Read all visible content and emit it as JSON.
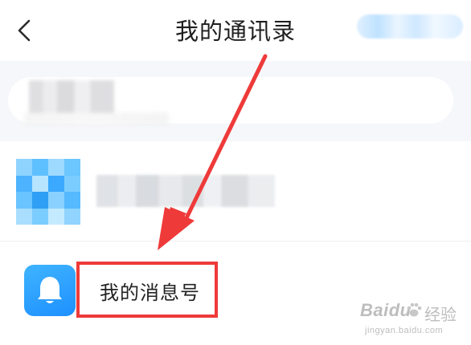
{
  "header": {
    "title": "我的通讯录",
    "back_icon": "chevron-left-icon",
    "action_text": ""
  },
  "search": {
    "placeholder": ""
  },
  "contacts": [
    {
      "name": "",
      "avatar": "avatar"
    }
  ],
  "message_account": {
    "label": "我的消息号",
    "icon": "bell-icon",
    "icon_bg": "#1e90ff"
  },
  "annotation": {
    "box_color": "#ef3a3a",
    "arrow_color": "#ef3a3a"
  },
  "watermark": {
    "logo": "Baidu",
    "suffix": "经验",
    "url": "jingyan.baidu.com"
  }
}
